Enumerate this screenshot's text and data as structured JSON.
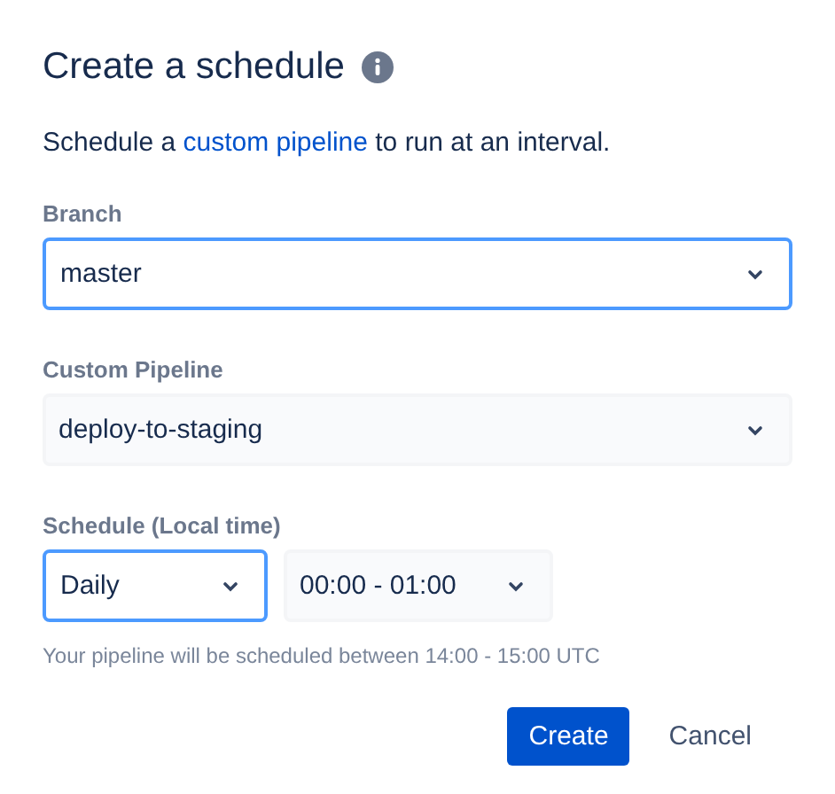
{
  "title": "Create a schedule",
  "description": {
    "before": "Schedule a ",
    "link": "custom pipeline",
    "after": " to run at an interval."
  },
  "fields": [
    {
      "label": "Branch",
      "selects": [
        {
          "value": "master",
          "focused": true
        }
      ]
    },
    {
      "label": "Custom Pipeline",
      "selects": [
        {
          "value": "deploy-to-staging",
          "focused": false
        }
      ]
    },
    {
      "label": "Schedule (Local time)",
      "selects": [
        {
          "value": "Daily",
          "focused": true
        },
        {
          "value": "00:00 - 01:00",
          "focused": false
        }
      ]
    }
  ],
  "helper": "Your pipeline will be scheduled between 14:00 - 15:00 UTC",
  "buttons": [
    {
      "label": "Create",
      "kind": "primary"
    },
    {
      "label": "Cancel",
      "kind": "subtle"
    }
  ]
}
